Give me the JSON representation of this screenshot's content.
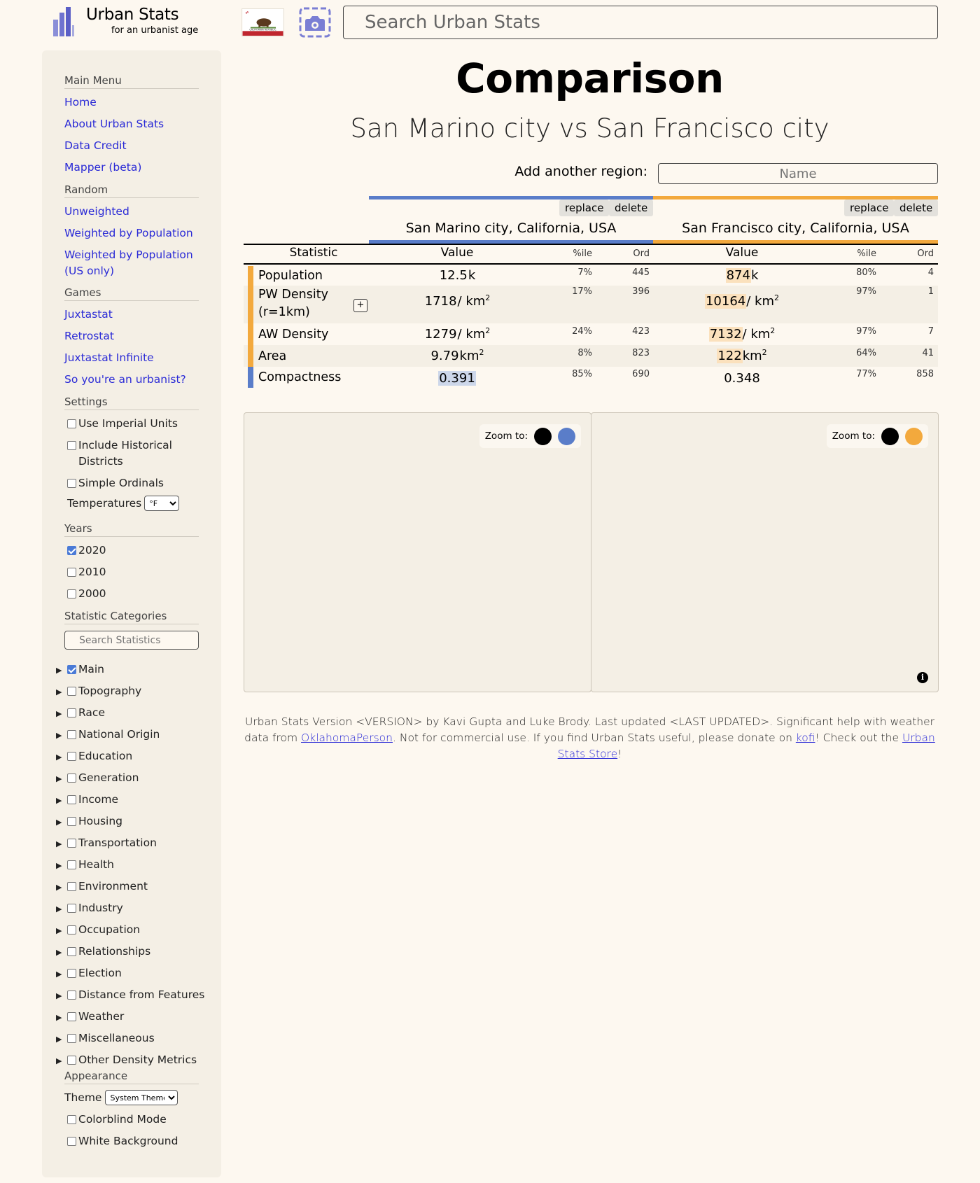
{
  "header": {
    "brand_title": "Urban Stats",
    "brand_tagline": "for an urbanist age",
    "search_placeholder": "Search Urban Stats",
    "flag_text": "CALIFORNIA REPUBLIC"
  },
  "sidebar": {
    "main_menu_heading": "Main Menu",
    "main_menu": [
      "Home",
      "About Urban Stats",
      "Data Credit",
      "Mapper (beta)"
    ],
    "random_heading": "Random",
    "random": [
      "Unweighted",
      "Weighted by Population",
      "Weighted by Population (US only)"
    ],
    "games_heading": "Games",
    "games": [
      "Juxtastat",
      "Retrostat",
      "Juxtastat Infinite",
      "So you're an urbanist?"
    ],
    "settings_heading": "Settings",
    "settings": {
      "imperial": "Use Imperial Units",
      "historical": "Include Historical Districts",
      "simple_ordinals": "Simple Ordinals",
      "temperatures_label": "Temperatures",
      "temperatures_value": "°F"
    },
    "years_heading": "Years",
    "years": [
      {
        "label": "2020",
        "checked": true
      },
      {
        "label": "2010",
        "checked": false
      },
      {
        "label": "2000",
        "checked": false
      }
    ],
    "categories_heading": "Statistic Categories",
    "categories_search_placeholder": "Search Statistics",
    "categories": [
      {
        "label": "Main",
        "checked": true
      },
      {
        "label": "Topography",
        "checked": false
      },
      {
        "label": "Race",
        "checked": false
      },
      {
        "label": "National Origin",
        "checked": false
      },
      {
        "label": "Education",
        "checked": false
      },
      {
        "label": "Generation",
        "checked": false
      },
      {
        "label": "Income",
        "checked": false
      },
      {
        "label": "Housing",
        "checked": false
      },
      {
        "label": "Transportation",
        "checked": false
      },
      {
        "label": "Health",
        "checked": false
      },
      {
        "label": "Environment",
        "checked": false
      },
      {
        "label": "Industry",
        "checked": false
      },
      {
        "label": "Occupation",
        "checked": false
      },
      {
        "label": "Relationships",
        "checked": false
      },
      {
        "label": "Election",
        "checked": false
      },
      {
        "label": "Distance from Features",
        "checked": false
      },
      {
        "label": "Weather",
        "checked": false
      },
      {
        "label": "Miscellaneous",
        "checked": false
      },
      {
        "label": "Other Density Metrics",
        "checked": false
      }
    ],
    "appearance_heading": "Appearance",
    "appearance": {
      "theme_label": "Theme",
      "theme_value": "System Theme",
      "colorblind": "Colorblind Mode",
      "white_bg": "White Background"
    }
  },
  "main": {
    "title": "Comparison",
    "subtitle": "San Marino city vs San Francisco city",
    "add_region_label": "Add another region:",
    "add_region_placeholder": "Name",
    "replace_label": "replace",
    "delete_label": "delete",
    "regions": [
      {
        "name": "San Marino city, California, USA",
        "color": "#5a7dc9"
      },
      {
        "name": "San Francisco city, California, USA",
        "color": "#f3a93d"
      }
    ],
    "headers": {
      "statistic": "Statistic",
      "value": "Value",
      "pctile": "%ile",
      "ord": "Ord"
    },
    "expand_label": "+",
    "rows": [
      {
        "stat": "Population",
        "cells": [
          {
            "num": "12.5",
            "unit": "k",
            "sup": "",
            "pct": "7%",
            "ord": "445"
          },
          {
            "num": "874",
            "unit": "k",
            "sup": "",
            "pct": "80%",
            "ord": "4"
          }
        ]
      },
      {
        "stat": "PW Density (r=1km)",
        "cells": [
          {
            "num": "1718",
            "unit": "/ km",
            "sup": "2",
            "pct": "17%",
            "ord": "396"
          },
          {
            "num": "10164",
            "unit": "/ km",
            "sup": "2",
            "pct": "97%",
            "ord": "1"
          }
        ]
      },
      {
        "stat": "AW Density",
        "cells": [
          {
            "num": "1279",
            "unit": "/ km",
            "sup": "2",
            "pct": "24%",
            "ord": "423"
          },
          {
            "num": "7132",
            "unit": "/ km",
            "sup": "2",
            "pct": "97%",
            "ord": "7"
          }
        ]
      },
      {
        "stat": "Area",
        "cells": [
          {
            "num": "9.79",
            "unit": "km",
            "sup": "2",
            "pct": "8%",
            "ord": "823"
          },
          {
            "num": "122",
            "unit": "km",
            "sup": "2",
            "pct": "64%",
            "ord": "41"
          }
        ]
      },
      {
        "stat": "Compactness",
        "cells": [
          {
            "num": "0.391",
            "unit": "",
            "sup": "",
            "pct": "85%",
            "ord": "690"
          },
          {
            "num": "0.348",
            "unit": "",
            "sup": "",
            "pct": "77%",
            "ord": "858"
          }
        ]
      }
    ],
    "zoom_label": "Zoom to:",
    "info_icon": "i"
  },
  "footer": {
    "part1": "Urban Stats Version <VERSION> by Kavi Gupta and Luke Brody. Last updated <LAST UPDATED>. Significant help with weather data from ",
    "link1": "OklahomaPerson",
    "part2": ". Not for commercial use. If you find Urban Stats useful, please donate on ",
    "link2": "kofi",
    "part3": "! Check out the ",
    "link3": "Urban Stats Store",
    "part4": "!"
  }
}
